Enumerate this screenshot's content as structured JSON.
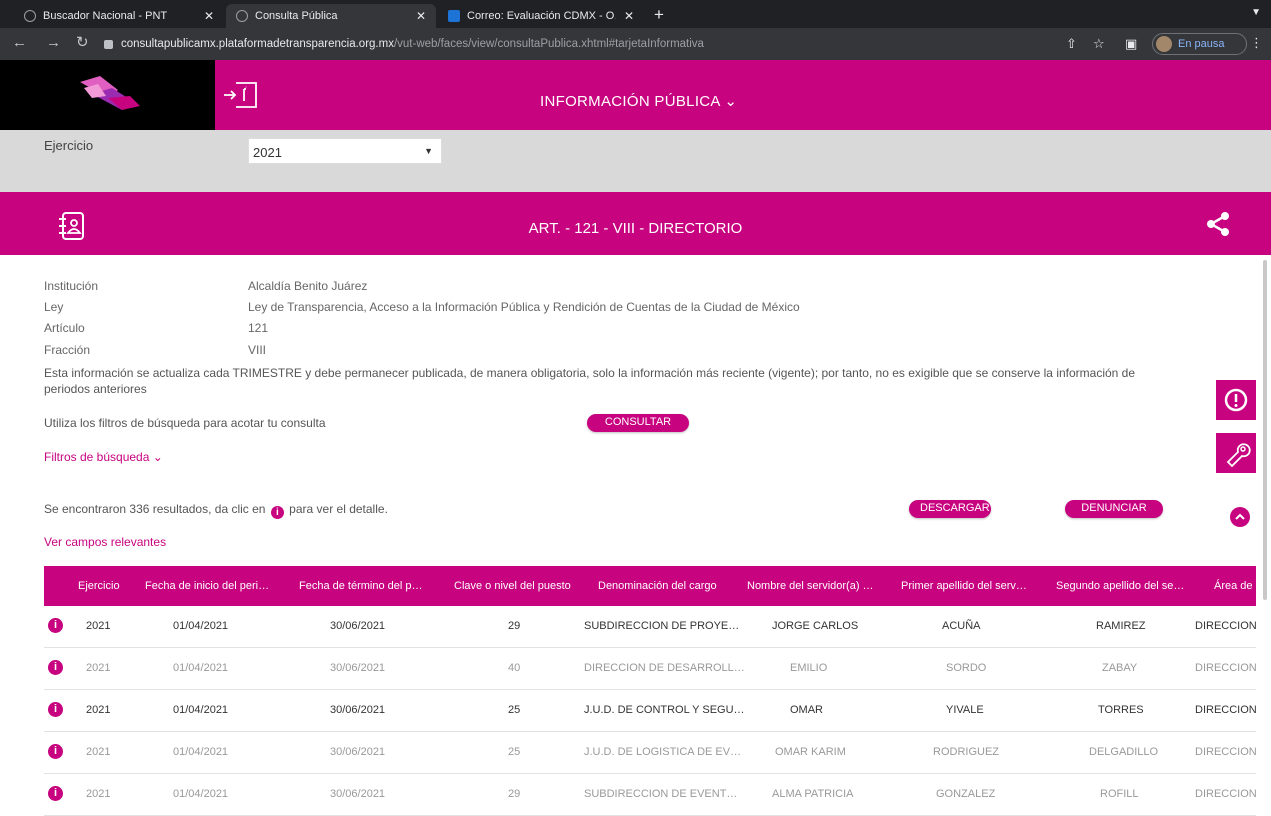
{
  "browser": {
    "tabs": [
      {
        "title": "Buscador Nacional - PNT"
      },
      {
        "title": "Consulta Pública"
      },
      {
        "title": "Correo: Evaluación CDMX - O…"
      }
    ],
    "url_host": "consultapublicamx.plataformadetransparencia.org.mx",
    "url_path": "/vut-web/faces/view/consultaPublica.xhtml#tarjetaInformativa",
    "profile_label": "En pausa"
  },
  "header": {
    "menu_label": "INFORMACIÓN PÚBLICA ⌄",
    "ejercicio_label": "Ejercicio",
    "ejercicio_value": "2021"
  },
  "section": {
    "title": "ART. - 121 - VIII - DIRECTORIO"
  },
  "info": {
    "institucion_label": "Institución",
    "institucion_value": "Alcaldía Benito Juárez",
    "ley_label": "Ley",
    "ley_value": "Ley de Transparencia, Acceso a la Información Pública y Rendición de Cuentas de la Ciudad de México",
    "articulo_label": "Artículo",
    "articulo_value": "121",
    "fraccion_label": "Fracción",
    "fraccion_value": "VIII",
    "description": "Esta información se actualiza cada TRIMESTRE y debe permanecer publicada, de manera obligatoria, solo la información más reciente (vigente); por tanto, no es exigible que se conserve la información de periodos anteriores",
    "filters_hint": "Utiliza los filtros de búsqueda para acotar tu consulta",
    "consultar_label": "CONSULTAR",
    "filtros_label": "Filtros de búsqueda ⌄",
    "results_prefix": "Se encontraron 336 resultados, da clic en",
    "results_suffix": "para ver el detalle.",
    "descargar_label": "DESCARGAR",
    "denunciar_label": "DENUNCIAR",
    "campos_label": "Ver campos relevantes"
  },
  "table": {
    "headers": [
      "Ejercicio",
      "Fecha de inicio del peri…",
      "Fecha de término del p…",
      "Clave o nivel del puesto",
      "Denominación del cargo",
      "Nombre del servidor(a) …",
      "Primer apellido del serv…",
      "Segundo apellido del se…",
      "Área de"
    ],
    "rows": [
      [
        "2021",
        "01/04/2021",
        "30/06/2021",
        "29",
        "SUBDIRECCION DE PROYE…",
        "JORGE CARLOS",
        "ACUÑA",
        "RAMIREZ",
        "DIRECCION"
      ],
      [
        "2021",
        "01/04/2021",
        "30/06/2021",
        "40",
        "DIRECCION DE DESARROLL…",
        "EMILIO",
        "SORDO",
        "ZABAY",
        "DIRECCION"
      ],
      [
        "2021",
        "01/04/2021",
        "30/06/2021",
        "25",
        "J.U.D. DE CONTROL Y SEGU…",
        "OMAR",
        "YIVALE",
        "TORRES",
        "DIRECCION"
      ],
      [
        "2021",
        "01/04/2021",
        "30/06/2021",
        "25",
        "J.U.D. DE LOGISTICA DE EV…",
        "OMAR KARIM",
        "RODRIGUEZ",
        "DELGADILLO",
        "DIRECCION"
      ],
      [
        "2021",
        "01/04/2021",
        "30/06/2021",
        "29",
        "SUBDIRECCION DE EVENT…",
        "ALMA PATRICIA",
        "GONZALEZ",
        "ROFILL",
        "DIRECCION"
      ]
    ]
  },
  "colors": {
    "brand_magenta": "#c7037f",
    "chrome_dark": "#202124"
  }
}
